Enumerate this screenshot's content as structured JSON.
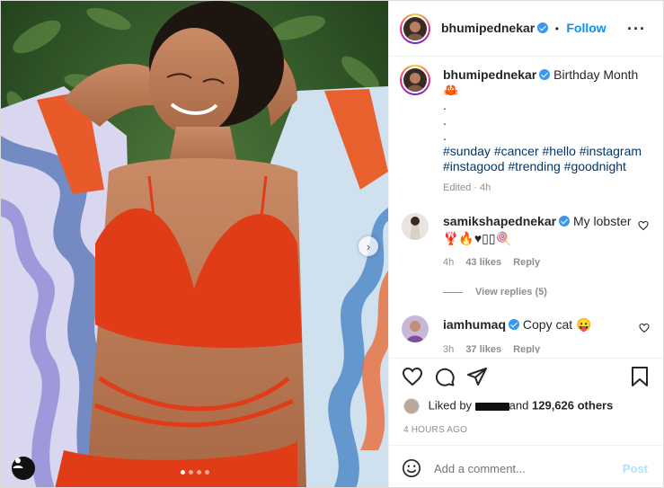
{
  "post": {
    "username": "bhumipednekar",
    "follow_label": "Follow",
    "separator": "•",
    "caption_text": "Birthday Month",
    "caption_emoji": "🦀",
    "caption_dots": [
      ".",
      ".",
      "."
    ],
    "hashtags_line1": "#sunday #cancer #hello #instagram",
    "hashtags_line2": "#instagood #trending #goodnight",
    "edited_label": "Edited · 4h",
    "more_icon": "more-horizontal-icon"
  },
  "comments": [
    {
      "username": "samikshapednekar",
      "text": "My lobster",
      "line2": "🦞🔥♥▯▯🍭",
      "time": "4h",
      "likes": "43 likes",
      "reply_label": "Reply",
      "view_replies": "View replies (5)"
    },
    {
      "username": "iamhumaq",
      "text": "Copy cat 😛",
      "time": "3h",
      "likes": "37 likes",
      "reply_label": "Reply"
    }
  ],
  "likes": {
    "liked_by_prefix": "Liked by",
    "liked_by_user": "redacted",
    "and_others": "and",
    "count": "129,626 others",
    "timestamp": "4 HOURS AGO"
  },
  "comment_box": {
    "placeholder": "Add a comment...",
    "post_label": "Post"
  },
  "carousel": {
    "total": 4,
    "active_index": 0
  },
  "colors": {
    "accent": "#0095f6",
    "hashtag": "#00376b",
    "muted": "#8e8e8e",
    "verified": "#3897f0"
  }
}
